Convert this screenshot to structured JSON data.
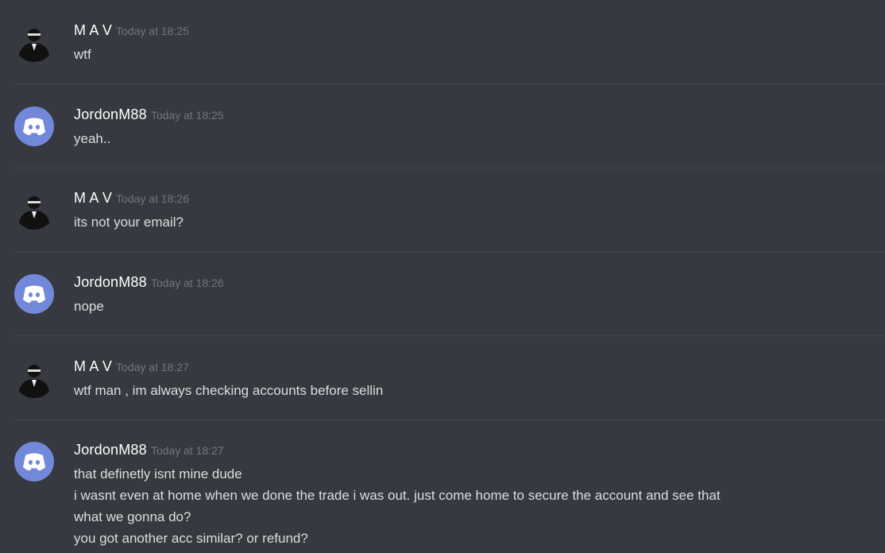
{
  "messages": [
    {
      "author": "M A V",
      "timestamp": "Today at 18:25",
      "avatar": "mav-avatar",
      "lines": [
        "wtf"
      ]
    },
    {
      "author": "JordonM88",
      "timestamp": "Today at 18:25",
      "avatar": "discord-default-avatar",
      "lines": [
        "yeah.."
      ]
    },
    {
      "author": "M A V",
      "timestamp": "Today at 18:26",
      "avatar": "mav-avatar",
      "lines": [
        "its not your email?"
      ]
    },
    {
      "author": "JordonM88",
      "timestamp": "Today at 18:26",
      "avatar": "discord-default-avatar",
      "lines": [
        "nope"
      ]
    },
    {
      "author": "M A V",
      "timestamp": "Today at 18:27",
      "avatar": "mav-avatar",
      "lines": [
        "wtf man , im always checking accounts before sellin"
      ]
    },
    {
      "author": "JordonM88",
      "timestamp": "Today at 18:27",
      "avatar": "discord-default-avatar",
      "lines": [
        "that definetly isnt mine dude",
        "i wasnt even at home when we done the trade i was out. just come home to secure the account and see that",
        "what we gonna do?",
        "you got another acc similar? or refund?"
      ]
    }
  ],
  "colors": {
    "background": "#36393f",
    "username": "#ffffff",
    "timestamp": "#72767d",
    "text": "#dcddde",
    "discord_blurple": "#7289da"
  }
}
